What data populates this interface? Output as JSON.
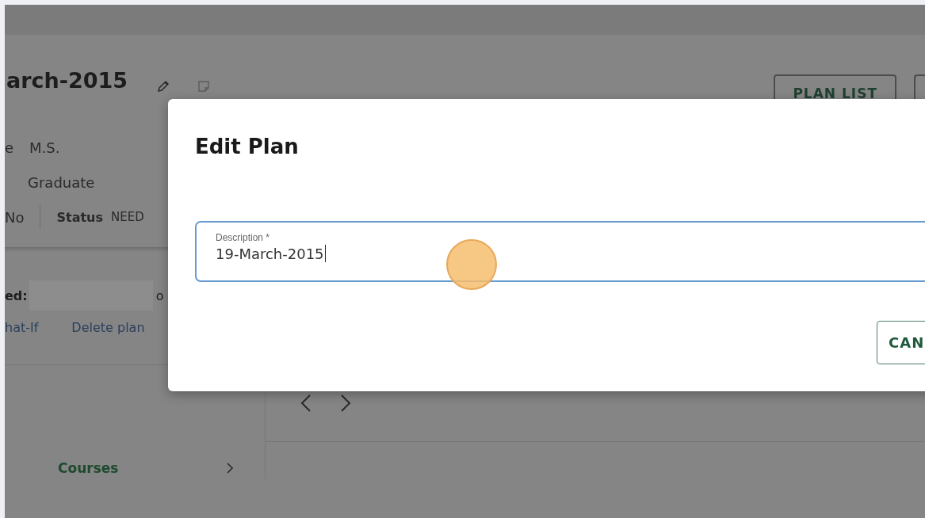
{
  "page": {
    "title": "arch-2015",
    "header_buttons": [
      {
        "label": "PLAN LIST"
      }
    ],
    "details": {
      "degree_label": "e",
      "degree": "M.S.",
      "level": "Graduate",
      "flag_value": "No",
      "status_label": "Status",
      "status": "NEED"
    },
    "saved": {
      "label": "ed:",
      "suffix": "o"
    },
    "links": [
      "hat-If",
      "Delete plan"
    ],
    "sidebar": {
      "items": [
        {
          "label": "Courses"
        }
      ]
    }
  },
  "dialog": {
    "title": "Edit Plan",
    "field": {
      "label": "Description *",
      "value": "19-March-2015",
      "focused": true
    },
    "buttons": [
      {
        "label": "CAN"
      }
    ]
  }
}
